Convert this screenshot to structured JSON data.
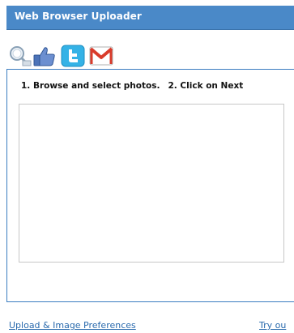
{
  "app": {
    "title": "Web Browser Uploader"
  },
  "sources": [
    {
      "name": "search",
      "icon": "magnifier-icon"
    },
    {
      "name": "facebook",
      "icon": "thumbs-up-icon"
    },
    {
      "name": "twitter",
      "icon": "twitter-icon"
    },
    {
      "name": "gmail",
      "icon": "gmail-icon"
    }
  ],
  "instructions": {
    "step1": "1. Browse and select photos.",
    "step2": "2. Click on Next"
  },
  "footer": {
    "preferences_link": "Upload & Image Preferences",
    "try_link": "Try ou"
  },
  "colors": {
    "titlebar": "#4a89c8",
    "panel_border": "#3b7dc0",
    "link": "#2a6aad"
  }
}
